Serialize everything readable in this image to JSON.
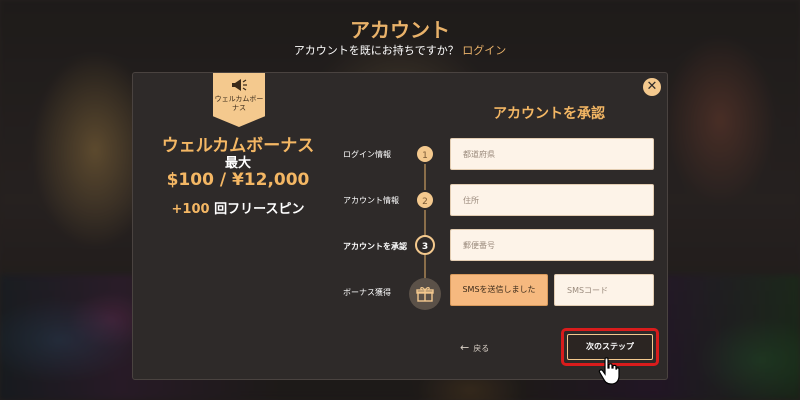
{
  "header": {
    "title": "アカウント",
    "subtitle": "アカウントを既にお持ちですか？",
    "login_link": "ログイン"
  },
  "promo": {
    "ribbon_icon": "megaphone-icon",
    "ribbon_text": "ウェルカムボーナス",
    "title": "ウェルカムボーナス",
    "max_label": "最大",
    "amount": "$100 / ¥12,000",
    "spins_count": "+100",
    "spins_label": "回フリースピン"
  },
  "form": {
    "title": "アカウントを承認",
    "close_icon": "close-icon",
    "steps": [
      {
        "number": "1",
        "label": "ログイン情報"
      },
      {
        "number": "2",
        "label": "アカウント情報"
      },
      {
        "number": "3",
        "label": "アカウントを承認"
      },
      {
        "number": "",
        "label": "ボーナス獲得",
        "icon": "gift-icon"
      }
    ],
    "active_step": 3,
    "fields": {
      "prefecture_placeholder": "都道府県",
      "address_placeholder": "住所",
      "postal_placeholder": "郵便番号",
      "sms_code_placeholder": "SMSコード"
    },
    "sms_button": "SMSを送信しました",
    "back_label": "戻る",
    "next_label": "次のステップ"
  },
  "colors": {
    "accent": "#f4b764",
    "highlight_border": "#d91c1c",
    "modal_bg": "#2e2a29"
  }
}
